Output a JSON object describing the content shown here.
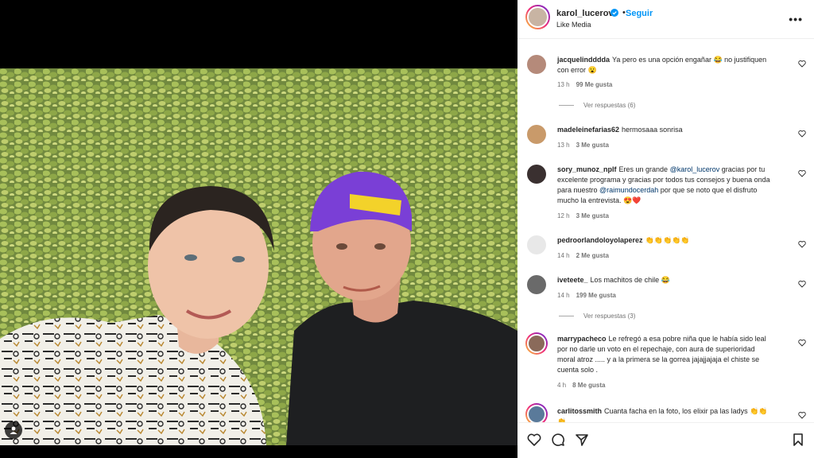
{
  "post": {
    "username": "karol_lucerov",
    "follow_label": "Seguir",
    "separator": "•",
    "subtitle": "Like Media",
    "more_label": "•••"
  },
  "comments": [
    {
      "user": "jacquelindddda",
      "text": "Ya pero es una opción engañar 😂 no justifiquen con error 😮",
      "time": "13 h",
      "likes": "99 Me gusta",
      "replies": "Ver respuestas (6)"
    },
    {
      "user": "madeleinefarias62",
      "text": "hermosaaa sonrisa",
      "time": "13 h",
      "likes": "3 Me gusta"
    },
    {
      "user": "sory_munoz_nplf",
      "text_parts": [
        "Eres un grande ",
        "@karol_lucerov",
        " gracias por tu excelente programa y gracias por todos tus consejos y buena onda para nuestro ",
        "@raimundocerdah",
        " por que se noto que el disfruto mucho la entrevista. 😍❤️"
      ],
      "time": "12 h",
      "likes": "3 Me gusta"
    },
    {
      "user": "pedroorlandoloyolaperez",
      "text": "👏👏👏👏👏",
      "time": "14 h",
      "likes": "2 Me gusta"
    },
    {
      "user": "iveteete_",
      "text": "Los machitos de chile 😂",
      "time": "14 h",
      "likes": "199 Me gusta",
      "replies": "Ver respuestas (3)"
    },
    {
      "user": "marrypacheco",
      "text": "Le refregó a esa pobre niña que le había sido leal por no darle un voto en el repechaje, con aura de superioridad moral atroz ..... y a la primera se la gorrea jajajjajaja el chiste se cuenta solo .",
      "time": "4 h",
      "likes": "8 Me gusta"
    },
    {
      "user": "carlitossmith",
      "text": "Cuanta facha en la foto, los elixir pa las ladys 👏👏👏"
    }
  ],
  "icons": {
    "like": "heart-icon",
    "comment": "comment-icon",
    "share": "send-icon",
    "save": "bookmark-icon",
    "tag": "user-tag-icon",
    "verified": "verified-badge-icon"
  },
  "colors": {
    "link": "#0095f6",
    "mention": "#00376b",
    "like_red": "#ed4956"
  }
}
